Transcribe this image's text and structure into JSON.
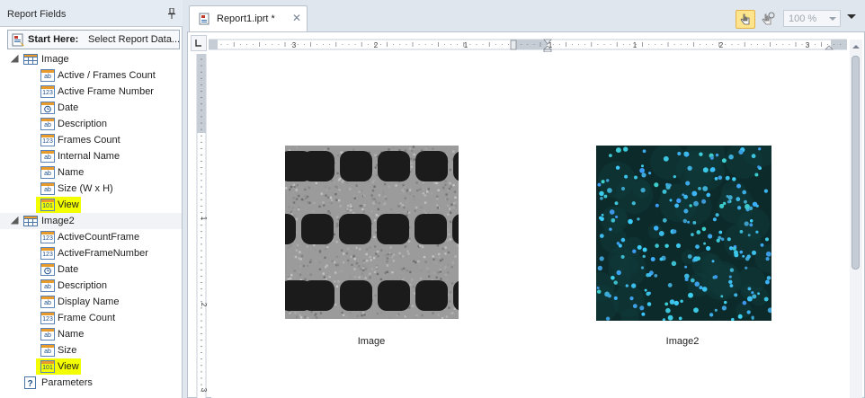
{
  "panel": {
    "title": "Report Fields",
    "start_here": {
      "bold": "Start Here:",
      "rest": "Select Report Data..."
    }
  },
  "tree": [
    {
      "label": "Image",
      "kind": "table",
      "expanded": true,
      "selected": false,
      "children": [
        {
          "label": "Active / Frames Count",
          "icon": "text-field-icon"
        },
        {
          "label": "Active Frame Number",
          "icon": "number-field-icon"
        },
        {
          "label": "Date",
          "icon": "date-field-icon"
        },
        {
          "label": "Description",
          "icon": "text-field-icon"
        },
        {
          "label": "Frames Count",
          "icon": "number-field-icon"
        },
        {
          "label": "Internal Name",
          "icon": "text-field-icon"
        },
        {
          "label": "Name",
          "icon": "text-field-icon"
        },
        {
          "label": "Size (W x H)",
          "icon": "text-field-icon"
        },
        {
          "label": "View",
          "icon": "binary-field-icon",
          "highlighted": true
        }
      ]
    },
    {
      "label": "Image2",
      "kind": "table",
      "expanded": true,
      "selected": true,
      "children": [
        {
          "label": "ActiveCountFrame",
          "icon": "number-field-icon"
        },
        {
          "label": "ActiveFrameNumber",
          "icon": "number-field-icon"
        },
        {
          "label": "Date",
          "icon": "date-field-icon"
        },
        {
          "label": "Description",
          "icon": "text-field-icon"
        },
        {
          "label": "Display Name",
          "icon": "text-field-icon"
        },
        {
          "label": "Frame Count",
          "icon": "number-field-icon"
        },
        {
          "label": "Name",
          "icon": "text-field-icon"
        },
        {
          "label": "Size",
          "icon": "text-field-icon"
        },
        {
          "label": "View",
          "icon": "binary-field-icon",
          "highlighted": true
        }
      ]
    },
    {
      "label": "Parameters",
      "kind": "parameters",
      "expanded": false,
      "selected": false,
      "children": []
    }
  ],
  "editor": {
    "tab_label": "Report1.iprt *",
    "tab_close": "✕",
    "zoom": "100 %",
    "ruler_numbers": [
      "3",
      "2",
      "1",
      "1",
      "1",
      "2",
      "3"
    ],
    "vruler_numbers": [
      "1",
      "2",
      "3"
    ]
  },
  "report": {
    "images": [
      {
        "caption": "Image",
        "kind": "grayscale-wells"
      },
      {
        "caption": "Image2",
        "kind": "fluorescent-cells"
      }
    ]
  },
  "colors": {
    "highlight": "#f3ff00",
    "accent": "#fde48d",
    "selected_row": "#f1f3f6"
  }
}
